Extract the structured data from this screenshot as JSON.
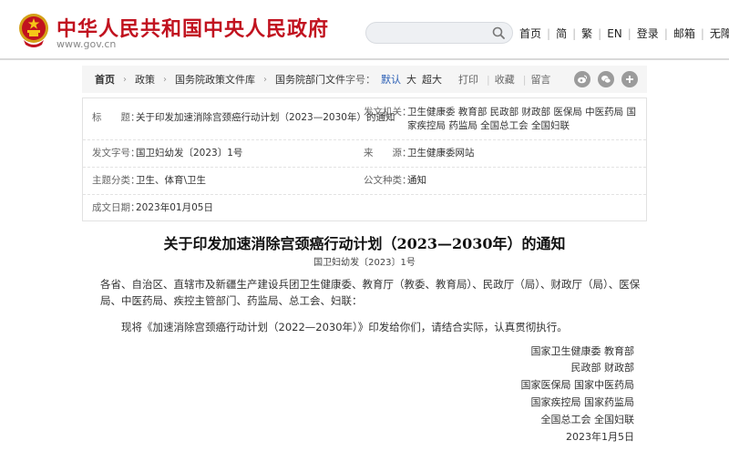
{
  "header": {
    "site_name": "中华人民共和国中央人民政府",
    "domain": "www.gov.cn",
    "links": [
      "首页",
      "简",
      "繁",
      "EN",
      "登录",
      "邮箱",
      "无障碍"
    ],
    "colors": {
      "brand_red": "#c1121f"
    }
  },
  "breadcrumb": [
    "首页",
    "政策",
    "国务院政策文件库",
    "国务院部门文件"
  ],
  "font_size": {
    "label": "字号：",
    "options": [
      "默认",
      "大",
      "超大"
    ],
    "active": "默认"
  },
  "tools": {
    "print": "打印",
    "favorite": "收藏",
    "comment": "留言"
  },
  "share_icons": [
    "weibo-icon",
    "wechat-icon",
    "plus-icon"
  ],
  "meta": {
    "title_label": "标　　题：",
    "title_value": "关于印发加速消除宫颈癌行动计划（2023—2030年）的通知",
    "issuer_label": "发文机关：",
    "issuer_value": "卫生健康委  教育部  民政部  财政部  医保局  中医药局  国家疾控局  药监局  全国总工会  全国妇联",
    "docno_label": "发文字号：",
    "docno_value": "国卫妇幼发〔2023〕1号",
    "source_label": "来　　源：",
    "source_value": "卫生健康委网站",
    "topic_label": "主题分类：",
    "topic_value": "卫生、体育\\卫生",
    "type_label": "公文种类：",
    "type_value": "通知",
    "date_label": "成文日期：",
    "date_value": "2023年01月05日"
  },
  "article": {
    "title": "关于印发加速消除宫颈癌行动计划（2023—2030年）的通知",
    "doc_number": "国卫妇幼发〔2023〕1号",
    "para1": "各省、自治区、直辖市及新疆生产建设兵团卫生健康委、教育厅（教委、教育局）、民政厅（局）、财政厅（局）、医保局、中医药局、疾控主管部门、药监局、总工会、妇联：",
    "para2": "现将《加速消除宫颈癌行动计划（2022—2030年）》印发给你们，请结合实际，认真贯彻执行。",
    "signatures": [
      "国家卫生健康委  教育部",
      "民政部  财政部",
      "国家医保局  国家中医药局",
      "国家疾控局  国家药监局",
      "全国总工会  全国妇联",
      "2023年1月5日"
    ]
  }
}
